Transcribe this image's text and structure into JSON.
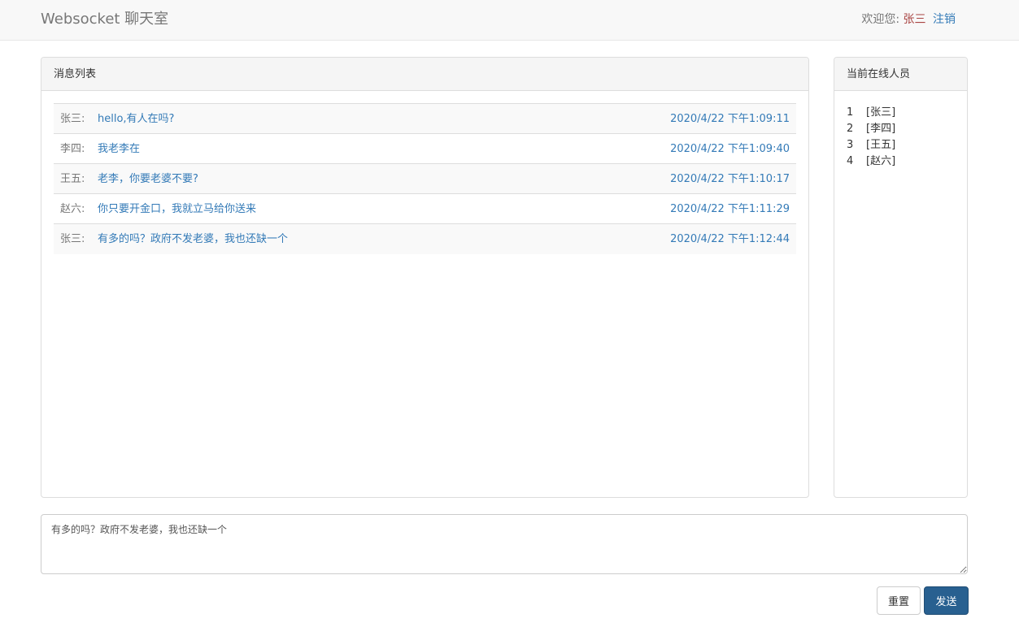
{
  "header": {
    "brand": "Websocket 聊天室",
    "welcome_label": "欢迎您:",
    "username": "张三",
    "logout_label": "注销"
  },
  "message_panel": {
    "title": "消息列表",
    "messages": [
      {
        "sender": "张三:",
        "text": "hello,有人在吗?",
        "time": "2020/4/22 下午1:09:11"
      },
      {
        "sender": "李四:",
        "text": "我老李在",
        "time": "2020/4/22 下午1:09:40"
      },
      {
        "sender": "王五:",
        "text": "老李，你要老婆不要?",
        "time": "2020/4/22 下午1:10:17"
      },
      {
        "sender": "赵六:",
        "text": "你只要开金口，我就立马给你送来",
        "time": "2020/4/22 下午1:11:29"
      },
      {
        "sender": "张三:",
        "text": "有多的吗？政府不发老婆，我也还缺一个",
        "time": "2020/4/22 下午1:12:44"
      }
    ]
  },
  "online_panel": {
    "title": "当前在线人员",
    "users": [
      {
        "num": "1",
        "name": "[张三]"
      },
      {
        "num": "2",
        "name": "[李四]"
      },
      {
        "num": "3",
        "name": "[王五]"
      },
      {
        "num": "4",
        "name": "[赵六]"
      }
    ]
  },
  "composer": {
    "value": "有多的吗？政府不发老婆，我也还缺一个",
    "reset_label": "重置",
    "send_label": "发送"
  },
  "colors": {
    "primary": "#286090",
    "link": "#337ab7",
    "username": "#a94442"
  }
}
